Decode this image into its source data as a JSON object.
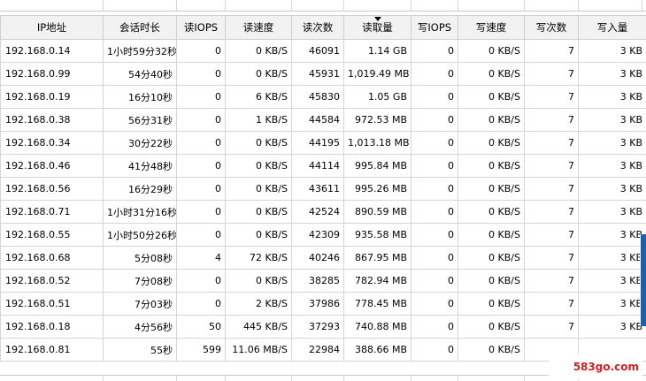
{
  "table": {
    "columns": [
      {
        "key": "ip",
        "label": "IP地址"
      },
      {
        "key": "session",
        "label": "会话时长"
      },
      {
        "key": "read_iops",
        "label": "读IOPS"
      },
      {
        "key": "read_speed",
        "label": "读速度"
      },
      {
        "key": "read_count",
        "label": "读次数"
      },
      {
        "key": "read_amount",
        "label": "读取量",
        "sorted": true
      },
      {
        "key": "write_iops",
        "label": "写IOPS"
      },
      {
        "key": "write_speed",
        "label": "写速度"
      },
      {
        "key": "write_count",
        "label": "写次数"
      },
      {
        "key": "write_amount",
        "label": "写入量"
      }
    ],
    "rows": [
      {
        "ip": "192.168.0.14",
        "session": "1小时59分32秒",
        "read_iops": "0",
        "read_speed": "0 KB/S",
        "read_count": "46091",
        "read_amount": "1.14 GB",
        "write_iops": "0",
        "write_speed": "0 KB/S",
        "write_count": "7",
        "write_amount": "3 KB"
      },
      {
        "ip": "192.168.0.99",
        "session": "54分40秒",
        "read_iops": "0",
        "read_speed": "0 KB/S",
        "read_count": "45931",
        "read_amount": "1,019.49 MB",
        "write_iops": "0",
        "write_speed": "0 KB/S",
        "write_count": "7",
        "write_amount": "3 KB"
      },
      {
        "ip": "192.168.0.19",
        "session": "16分10秒",
        "read_iops": "0",
        "read_speed": "6 KB/S",
        "read_count": "45830",
        "read_amount": "1.05 GB",
        "write_iops": "0",
        "write_speed": "0 KB/S",
        "write_count": "7",
        "write_amount": "3 KB"
      },
      {
        "ip": "192.168.0.38",
        "session": "56分31秒",
        "read_iops": "0",
        "read_speed": "1 KB/S",
        "read_count": "44584",
        "read_amount": "972.53 MB",
        "write_iops": "0",
        "write_speed": "0 KB/S",
        "write_count": "7",
        "write_amount": "3 KB"
      },
      {
        "ip": "192.168.0.34",
        "session": "30分22秒",
        "read_iops": "0",
        "read_speed": "0 KB/S",
        "read_count": "44195",
        "read_amount": "1,013.18 MB",
        "write_iops": "0",
        "write_speed": "0 KB/S",
        "write_count": "7",
        "write_amount": "3 KB"
      },
      {
        "ip": "192.168.0.46",
        "session": "41分48秒",
        "read_iops": "0",
        "read_speed": "0 KB/S",
        "read_count": "44114",
        "read_amount": "995.84 MB",
        "write_iops": "0",
        "write_speed": "0 KB/S",
        "write_count": "7",
        "write_amount": "3 KB"
      },
      {
        "ip": "192.168.0.56",
        "session": "16分29秒",
        "read_iops": "0",
        "read_speed": "0 KB/S",
        "read_count": "43611",
        "read_amount": "995.26 MB",
        "write_iops": "0",
        "write_speed": "0 KB/S",
        "write_count": "7",
        "write_amount": "3 KB"
      },
      {
        "ip": "192.168.0.71",
        "session": "1小时31分16秒",
        "read_iops": "0",
        "read_speed": "0 KB/S",
        "read_count": "42524",
        "read_amount": "890.59 MB",
        "write_iops": "0",
        "write_speed": "0 KB/S",
        "write_count": "7",
        "write_amount": "3 KB"
      },
      {
        "ip": "192.168.0.55",
        "session": "1小时50分26秒",
        "read_iops": "0",
        "read_speed": "0 KB/S",
        "read_count": "42309",
        "read_amount": "935.58 MB",
        "write_iops": "0",
        "write_speed": "0 KB/S",
        "write_count": "7",
        "write_amount": "3 KB"
      },
      {
        "ip": "192.168.0.68",
        "session": "5分08秒",
        "read_iops": "4",
        "read_speed": "72 KB/S",
        "read_count": "40246",
        "read_amount": "867.95 MB",
        "write_iops": "0",
        "write_speed": "0 KB/S",
        "write_count": "7",
        "write_amount": "3 KB"
      },
      {
        "ip": "192.168.0.52",
        "session": "7分08秒",
        "read_iops": "0",
        "read_speed": "0 KB/S",
        "read_count": "38285",
        "read_amount": "782.94 MB",
        "write_iops": "0",
        "write_speed": "0 KB/S",
        "write_count": "7",
        "write_amount": "3 KB"
      },
      {
        "ip": "192.168.0.51",
        "session": "7分03秒",
        "read_iops": "0",
        "read_speed": "2 KB/S",
        "read_count": "37986",
        "read_amount": "778.45 MB",
        "write_iops": "0",
        "write_speed": "0 KB/S",
        "write_count": "7",
        "write_amount": "3 KB"
      },
      {
        "ip": "192.168.0.18",
        "session": "4分56秒",
        "read_iops": "50",
        "read_speed": "445 KB/S",
        "read_count": "37293",
        "read_amount": "740.88 MB",
        "write_iops": "0",
        "write_speed": "0 KB/S",
        "write_count": "7",
        "write_amount": "3 KB"
      },
      {
        "ip": "192.168.0.81",
        "session": "55秒",
        "read_iops": "599",
        "read_speed": "11.06 MB/S",
        "read_count": "22984",
        "read_amount": "388.66 MB",
        "write_iops": "0",
        "write_speed": "0 KB/S",
        "write_count": "",
        "write_amount": ""
      }
    ]
  },
  "watermark": {
    "text": "583go.com"
  },
  "colors": {
    "header_bg": "#f2f2f2",
    "grid_line": "#d4d4d4",
    "scroll_marker": "#1f5fa8",
    "watermark": "#d02020"
  }
}
